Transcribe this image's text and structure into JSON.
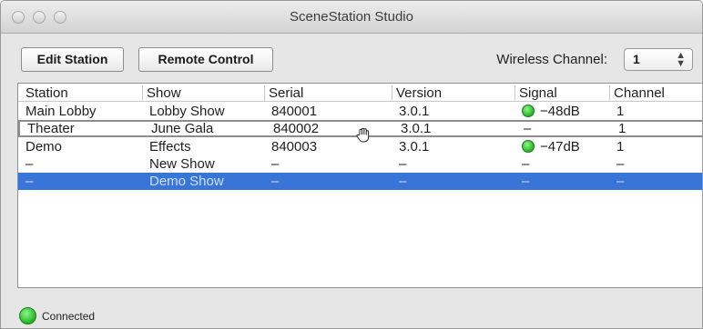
{
  "window": {
    "title": "SceneStation Studio"
  },
  "toolbar": {
    "edit_station_label": "Edit Station",
    "remote_control_label": "Remote Control",
    "wireless_channel_label": "Wireless Channel:",
    "wireless_channel_value": "1",
    "wireless_channel_arrows": "⌃⌄"
  },
  "table": {
    "columns": [
      "Station",
      "Show",
      "Serial",
      "Version",
      "Signal",
      "Channel"
    ],
    "rows": [
      {
        "station": "Main Lobby",
        "show": "Lobby Show",
        "serial": "840001",
        "version": "3.0.1",
        "signal": "−48dB",
        "signal_icon": "green-dot",
        "channel": "1"
      },
      {
        "station": "Theater",
        "show": "June Gala",
        "serial": "840002",
        "version": "3.0.1",
        "signal": "–",
        "channel": "1"
      },
      {
        "station": "Demo",
        "show": "Effects",
        "serial": "840003",
        "version": "3.0.1",
        "signal": "−47dB",
        "signal_icon": "green-dot",
        "channel": "1"
      },
      {
        "station": "–",
        "show": "New Show",
        "serial": "–",
        "version": "–",
        "signal": "–",
        "channel": "–"
      },
      {
        "station": "–",
        "show": "Demo Show",
        "serial": "–",
        "version": "–",
        "signal": "–",
        "channel": "–",
        "selected": true
      }
    ]
  },
  "status": {
    "text": "Connected",
    "color": "#23b523"
  },
  "colors": {
    "selection": "#3875d7",
    "status_green": "#23b523"
  }
}
